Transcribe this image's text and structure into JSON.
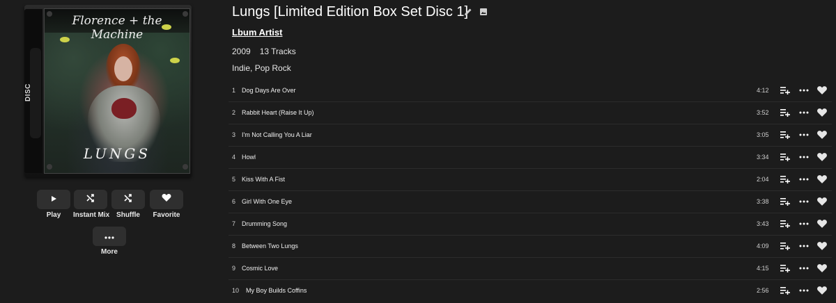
{
  "album": {
    "title": "Lungs [Limited Edition Box Set Disc 1]",
    "artist": "Lbum Artist",
    "year": "2009",
    "track_count": "13 Tracks",
    "genres": "Indie, Pop Rock",
    "cover": {
      "band_text": "Florence + the Machine",
      "album_text": "LUNGS",
      "spine_text": "DISC"
    }
  },
  "icons": {
    "edit": "pencil-icon",
    "image": "image-icon",
    "play": "play-icon",
    "instant_mix": "shuffle-icon",
    "shuffle": "shuffle-icon",
    "favorite": "heart-icon",
    "more": "more-icon",
    "add_to_playlist": "playlist-add-icon"
  },
  "actions": {
    "play": "Play",
    "instant_mix": "Instant Mix",
    "shuffle": "Shuffle",
    "favorite": "Favorite",
    "more": "More"
  },
  "colors": {
    "background": "#1c1c1c",
    "button": "#2f2f2f",
    "text": "#ffffff"
  },
  "tracks": [
    {
      "num": "1",
      "name": "Dog Days Are Over",
      "duration": "4:12"
    },
    {
      "num": "2",
      "name": "Rabbit Heart (Raise It Up)",
      "duration": "3:52"
    },
    {
      "num": "3",
      "name": "I'm Not Calling You A Liar",
      "duration": "3:05"
    },
    {
      "num": "4",
      "name": "Howl",
      "duration": "3:34"
    },
    {
      "num": "5",
      "name": "Kiss With A Fist",
      "duration": "2:04"
    },
    {
      "num": "6",
      "name": "Girl With One Eye",
      "duration": "3:38"
    },
    {
      "num": "7",
      "name": "Drumming Song",
      "duration": "3:43"
    },
    {
      "num": "8",
      "name": "Between Two Lungs",
      "duration": "4:09"
    },
    {
      "num": "9",
      "name": "Cosmic Love",
      "duration": "4:15"
    },
    {
      "num": "10",
      "name": "My Boy Builds Coffins",
      "duration": "2:56"
    }
  ]
}
